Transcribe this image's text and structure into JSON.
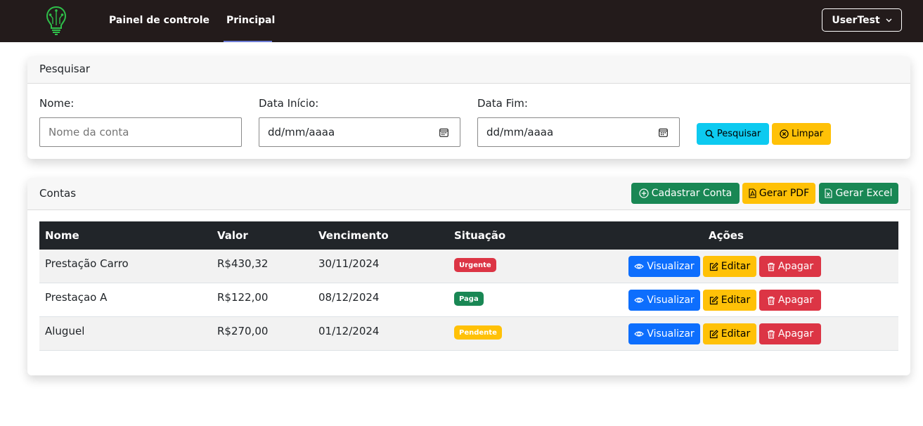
{
  "navbar": {
    "links": [
      "Painel de controle",
      "Principal"
    ],
    "user_label": "UserTest"
  },
  "search": {
    "title": "Pesquisar",
    "name_label": "Nome:",
    "name_placeholder": "Nome da conta",
    "start_label": "Data Início:",
    "start_value": "dd/mm/aaaa",
    "end_label": "Data Fim:",
    "end_value": "dd/mm/aaaa",
    "search_button": "Pesquisar",
    "clear_button": "Limpar"
  },
  "accounts": {
    "title": "Contas",
    "create_button": "Cadastrar Conta",
    "pdf_button": "Gerar PDF",
    "excel_button": "Gerar Excel",
    "columns": [
      "Nome",
      "Valor",
      "Vencimento",
      "Situação",
      "Ações"
    ],
    "actions": {
      "view": "Visualizar",
      "edit": "Editar",
      "delete": "Apagar"
    },
    "rows": [
      {
        "name": "Prestação Carro",
        "value": "R$430,32",
        "due": "30/11/2024",
        "status": "Urgente",
        "status_color": "#dc3545"
      },
      {
        "name": "Prestaçao A",
        "value": "R$122,00",
        "due": "08/12/2024",
        "status": "Paga",
        "status_color": "#198754"
      },
      {
        "name": "Aluguel",
        "value": "R$270,00",
        "due": "01/12/2024",
        "status": "Pendente",
        "status_color": "#ffc107"
      }
    ]
  },
  "colors": {
    "navbar_bg": "#231b1b",
    "info": "#0dcaf0",
    "warning": "#ffc107",
    "success": "#198754",
    "primary": "#0d6efd",
    "danger": "#dc3545",
    "table_header": "#212529"
  },
  "icons": [
    "lightbulb-logo-icon",
    "chevron-down-icon",
    "calendar-icon",
    "search-icon",
    "x-circle-icon",
    "plus-circle-icon",
    "file-pdf-icon",
    "file-excel-icon",
    "eye-icon",
    "pencil-square-icon",
    "trash-icon"
  ]
}
